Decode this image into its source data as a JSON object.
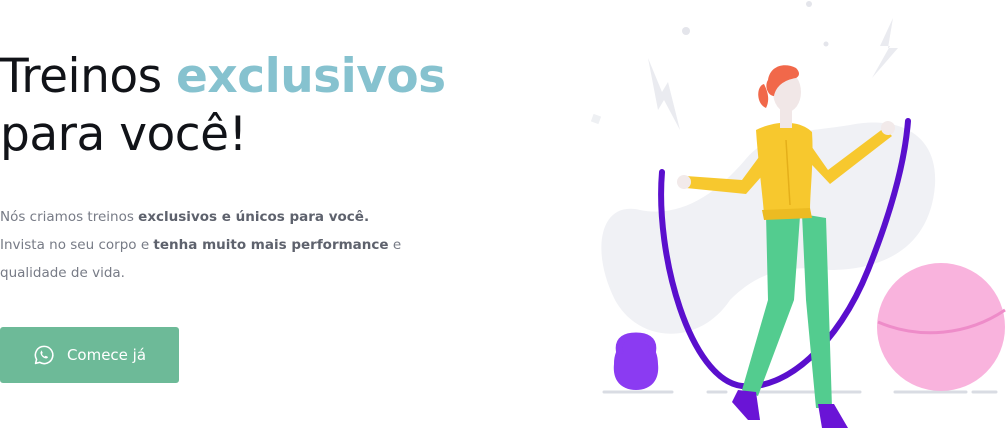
{
  "hero": {
    "title_line1_prefix": "Treinos ",
    "title_line1_accent": "exclusivos",
    "title_line2": "para você!",
    "p1_normal": "Nós criamos treinos ",
    "p1_bold": "exclusivos e únicos para você.",
    "p2_normal": "Invista no seu corpo e ",
    "p2_bold": "tenha muito mais performance",
    "p2_tail": " e",
    "p3": "qualidade de vida.",
    "cta_label": "Comece já",
    "cta_icon": "whatsapp-icon"
  },
  "colors": {
    "accent": "#86c2cf",
    "button": "#6dba98",
    "text": "#111318",
    "body_text": "#777b86"
  }
}
